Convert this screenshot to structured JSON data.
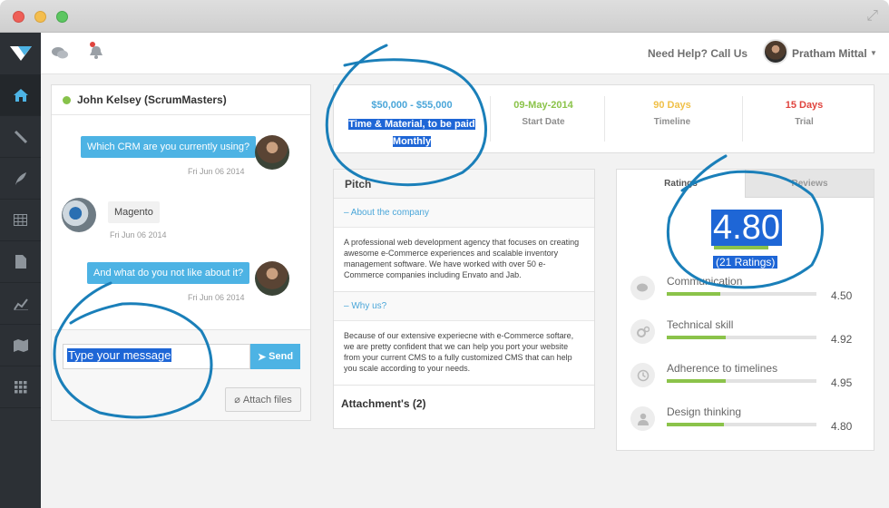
{
  "topbar": {
    "help_text": "Need Help? Call Us",
    "user_name": "Pratham Mittal"
  },
  "chat": {
    "contact": "John Kelsey (ScrumMasters)",
    "messages": [
      {
        "text": "Which CRM are you currently using?",
        "time": "Fri Jun 06 2014",
        "direction": "out"
      },
      {
        "text": "Magento",
        "time": "Fri Jun 06 2014",
        "direction": "in"
      },
      {
        "text": "And what do you not like about it?",
        "time": "Fri Jun 06 2014",
        "direction": "out"
      }
    ],
    "input_value": "Type your message",
    "send_label": "Send",
    "attach_label": "Attach files"
  },
  "stats": {
    "price": "$50,000 - $55,000",
    "terms": "Time & Material, to be paid Monthly",
    "start_date": "09-May-2014",
    "start_date_label": "Start Date",
    "timeline": "90 Days",
    "timeline_label": "Timeline",
    "trial": "15 Days",
    "trial_label": "Trial"
  },
  "pitch": {
    "title": "Pitch",
    "sections": [
      {
        "heading": "About the company",
        "body": "A professional web development agency that focuses on creating awesome e-Commerce experiences and scalable inventory management software. We have worked with over 50 e-Commerce companies including Envato and Jab."
      },
      {
        "heading": "Why us?",
        "body": "Because of our extensive experiecne with e-Commerce softare, we are pretty confident that we can help you port your website from your current CMS to a fully customized CMS that can help you scale according to your needs."
      }
    ],
    "attachments_label": "Attachment's (2)"
  },
  "ratings": {
    "tabs": [
      "Ratings",
      "Reviews"
    ],
    "overall": "4.80",
    "overall_value": 4.8,
    "count_label": "(21 Ratings)",
    "items": [
      {
        "label": "Communication",
        "value": "4.50",
        "score": 4.5,
        "icon": "chat-bubbles-icon"
      },
      {
        "label": "Technical skill",
        "value": "4.92",
        "score": 4.92,
        "icon": "gears-icon"
      },
      {
        "label": "Adherence to timelines",
        "value": "4.95",
        "score": 4.95,
        "icon": "clock-icon"
      },
      {
        "label": "Design thinking",
        "value": "4.80",
        "score": 4.8,
        "icon": "user-icon"
      }
    ]
  },
  "colors": {
    "accent": "#4db3e4",
    "green": "#8bc34a",
    "date": "#8bc34a",
    "timeline": "#f0c048",
    "trial": "#e0443e",
    "selection": "#1e66d6",
    "scribble": "#1a7fb9"
  }
}
